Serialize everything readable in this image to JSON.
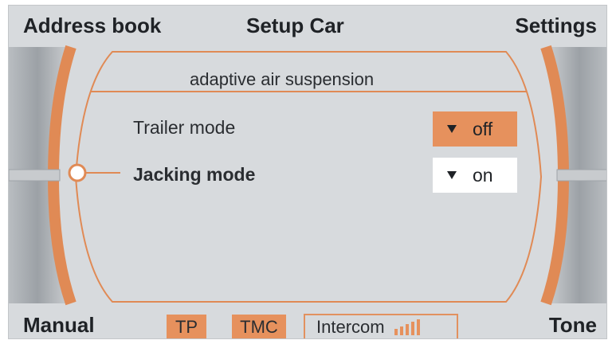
{
  "header": {
    "left_label": "Address book",
    "center_label": "Setup Car",
    "right_label": "Settings"
  },
  "panel": {
    "title": "adaptive air suspension",
    "rows": [
      {
        "label": "Trailer mode",
        "value": "off",
        "selected": false
      },
      {
        "label": "Jacking mode",
        "value": "on",
        "selected": true
      }
    ]
  },
  "footer": {
    "left_label": "Manual",
    "tp_label": "TP",
    "tmc_label": "TMC",
    "intercom_label": "Intercom",
    "right_label": "Tone"
  },
  "colors": {
    "accent": "#e6915d",
    "screen_bg": "#d7dadd",
    "text": "#1f2226"
  },
  "icons": {
    "dropdown": "triangle-down-icon",
    "selector": "circle-selector-icon",
    "signal": "signal-bars-icon"
  }
}
